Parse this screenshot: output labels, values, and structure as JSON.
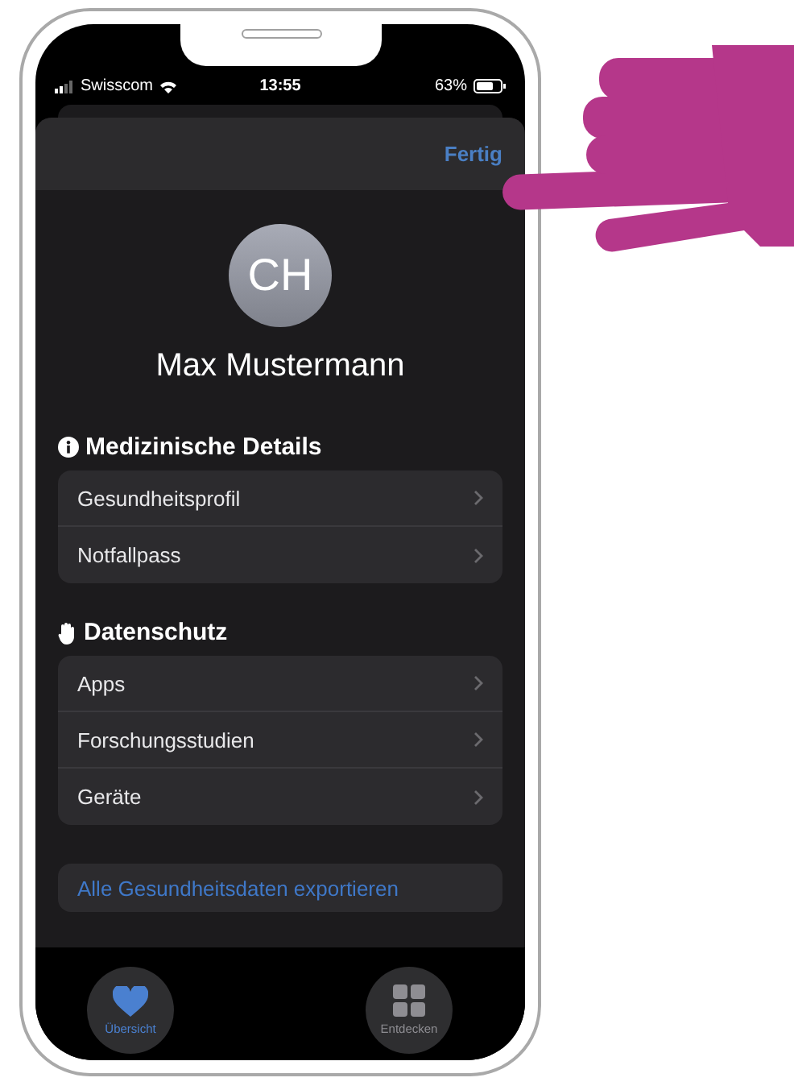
{
  "status_bar": {
    "carrier": "Swisscom",
    "time": "13:55",
    "battery": "63%"
  },
  "header": {
    "done_button": "Fertig"
  },
  "profile": {
    "initials": "CH",
    "name": "Max Mustermann"
  },
  "sections": [
    {
      "kind": "info",
      "title": "Medizinische Details",
      "items": [
        "Gesundheitsprofil",
        "Notfallpass"
      ]
    },
    {
      "kind": "hand",
      "title": "Datenschutz",
      "items": [
        "Apps",
        "Forschungsstudien",
        "Geräte"
      ]
    }
  ],
  "export_link": "Alle Gesundheitsdaten exportieren",
  "tabs": [
    {
      "kind": "heart",
      "label": "Übersicht",
      "selected": true
    },
    {
      "kind": "grid",
      "label": "Entdecken",
      "selected": false
    }
  ]
}
